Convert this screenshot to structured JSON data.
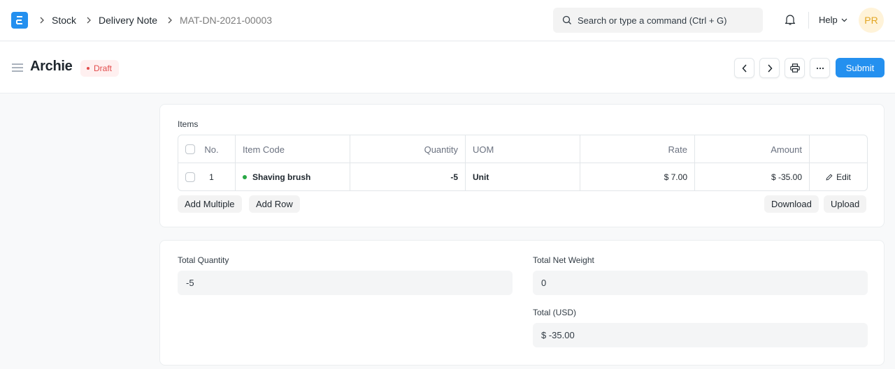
{
  "navbar": {
    "logo": "erpnext-logo-icon",
    "breadcrumbs": [
      "Stock",
      "Delivery Note",
      "MAT-DN-2021-00003"
    ],
    "search_placeholder": "Search or type a command (Ctrl + G)",
    "help_label": "Help",
    "avatar_initials": "PR"
  },
  "page": {
    "title": "Archie",
    "status": "Draft",
    "submit_label": "Submit",
    "colors": {
      "primary": "#2490ef",
      "draft": "#e24c4c"
    }
  },
  "items": {
    "label": "Items",
    "columns": [
      "No.",
      "Item Code",
      "Quantity",
      "UOM",
      "Rate",
      "Amount"
    ],
    "rows": [
      {
        "no": "1",
        "item_code": "Shaving brush",
        "quantity": "-5",
        "uom": "Unit",
        "rate": "$ 7.00",
        "amount": "$ -35.00",
        "edit_label": "Edit"
      }
    ],
    "buttons": {
      "add_multiple": "Add Multiple",
      "add_row": "Add Row",
      "download": "Download",
      "upload": "Upload"
    }
  },
  "totals": {
    "total_quantity_label": "Total Quantity",
    "total_quantity": "-5",
    "total_net_weight_label": "Total Net Weight",
    "total_net_weight": "0",
    "total_label": "Total (USD)",
    "total": "$ -35.00"
  }
}
